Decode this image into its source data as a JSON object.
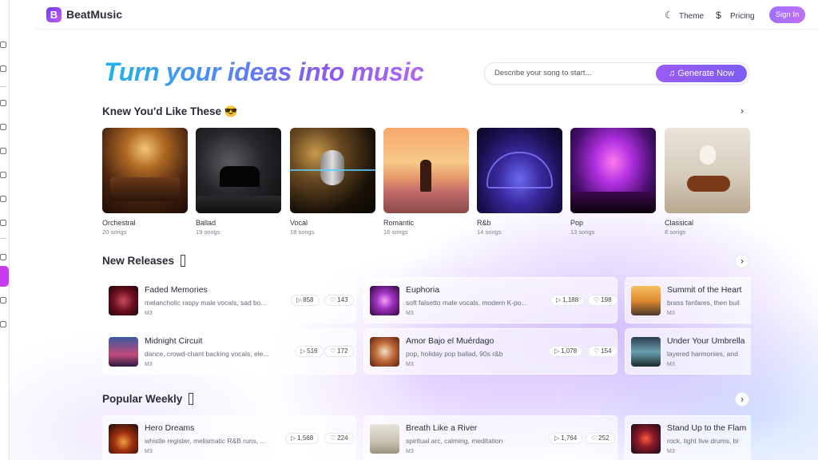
{
  "app": {
    "brand": "BeatMusic",
    "logo_letter": "B"
  },
  "header": {
    "theme_label": "Theme",
    "pricing_label": "Pricing",
    "signin_label": "Sign In"
  },
  "hero": {
    "title": "Turn your ideas into music",
    "input_placeholder": "Describe your song to start...",
    "generate_label": "Generate Now"
  },
  "sections": {
    "genres_title": "Knew You'd Like These 😎",
    "new_releases_title": "New Releases",
    "popular_title": "Popular Weekly"
  },
  "genres": [
    {
      "name": "Orchestral",
      "count": "20 songs"
    },
    {
      "name": "Ballad",
      "count": "19 songs"
    },
    {
      "name": "Vocal",
      "count": "18 songs"
    },
    {
      "name": "Romantic",
      "count": "16 songs"
    },
    {
      "name": "R&b",
      "count": "14 songs"
    },
    {
      "name": "Pop",
      "count": "13 songs"
    },
    {
      "name": "Classical",
      "count": "8 songs"
    }
  ],
  "new_releases": [
    {
      "title": "Faded Memories",
      "desc": "melancholic raspy male vocals, sad bo...",
      "model": "M3",
      "plays": "858",
      "likes": "143"
    },
    {
      "title": "Euphoria",
      "desc": "soft falsetto male vocals, modern K-po...",
      "model": "M3",
      "plays": "1,188",
      "likes": "198"
    },
    {
      "title": "Summit of the Heart",
      "desc": "brass fanfares, then buil",
      "model": "M3"
    },
    {
      "title": "Midnight Circuit",
      "desc": "dance, crowd-chant backing vocals, ele...",
      "model": "M3",
      "plays": "516",
      "likes": "172"
    },
    {
      "title": "Amor Bajo el Muérdago",
      "desc": "pop, holiday pop ballad, 90s r&b",
      "model": "M3",
      "plays": "1,078",
      "likes": "154"
    },
    {
      "title": "Under Your Umbrella",
      "desc": "layered harmonies, and",
      "model": "M3"
    }
  ],
  "popular": [
    {
      "title": "Hero Dreams",
      "desc": "whistle register, melismatic R&B runs, ...",
      "model": "M3",
      "plays": "1,568",
      "likes": "224"
    },
    {
      "title": "Breath Like a River",
      "desc": "spiritual arc, calming, meditation",
      "model": "M3",
      "plays": "1,764",
      "likes": "252"
    },
    {
      "title": "Stand Up to the Flam",
      "desc": "rock, tight live drums, bi",
      "model": "M3"
    }
  ]
}
